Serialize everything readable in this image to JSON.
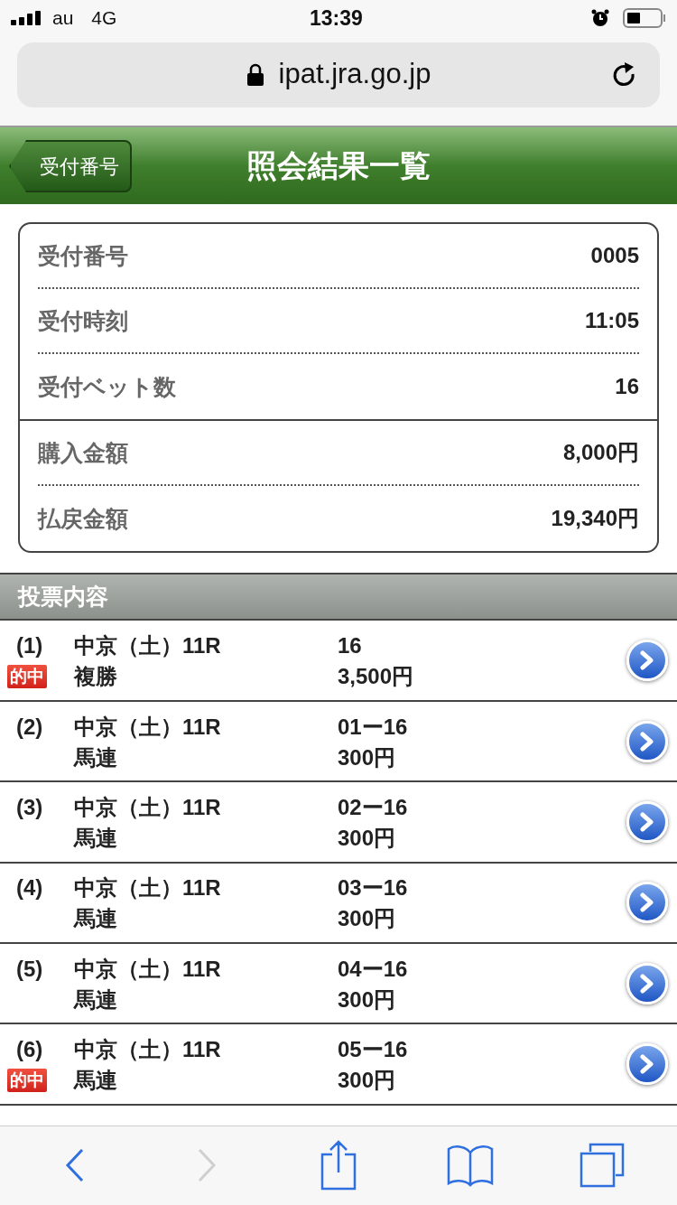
{
  "status_bar": {
    "carrier": "au",
    "network": "4G",
    "time": "13:39"
  },
  "browser": {
    "url": "ipat.jra.go.jp",
    "back_enabled": true,
    "forward_enabled": false
  },
  "header": {
    "back_button": "受付番号",
    "title": "照会結果一覧"
  },
  "summary": {
    "groups": [
      [
        {
          "label": "受付番号",
          "value": "0005"
        },
        {
          "label": "受付時刻",
          "value": "11:05"
        },
        {
          "label": "受付ベット数",
          "value": "16"
        }
      ],
      [
        {
          "label": "購入金額",
          "value": "8,000円"
        },
        {
          "label": "払戻金額",
          "value": "19,340円"
        }
      ]
    ]
  },
  "section_title": "投票内容",
  "bets": [
    {
      "number": "(1)",
      "race": "中京（土）11R",
      "type": "複勝",
      "selection": "16",
      "amount": "3,500円",
      "hit": true,
      "hit_label": "的中"
    },
    {
      "number": "(2)",
      "race": "中京（土）11R",
      "type": "馬連",
      "selection": "01ー16",
      "amount": "300円",
      "hit": false
    },
    {
      "number": "(3)",
      "race": "中京（土）11R",
      "type": "馬連",
      "selection": "02ー16",
      "amount": "300円",
      "hit": false
    },
    {
      "number": "(4)",
      "race": "中京（土）11R",
      "type": "馬連",
      "selection": "03ー16",
      "amount": "300円",
      "hit": false
    },
    {
      "number": "(5)",
      "race": "中京（土）11R",
      "type": "馬連",
      "selection": "04ー16",
      "amount": "300円",
      "hit": false
    },
    {
      "number": "(6)",
      "race": "中京（土）11R",
      "type": "馬連",
      "selection": "05ー16",
      "amount": "300円",
      "hit": true,
      "hit_label": "的中"
    }
  ]
}
